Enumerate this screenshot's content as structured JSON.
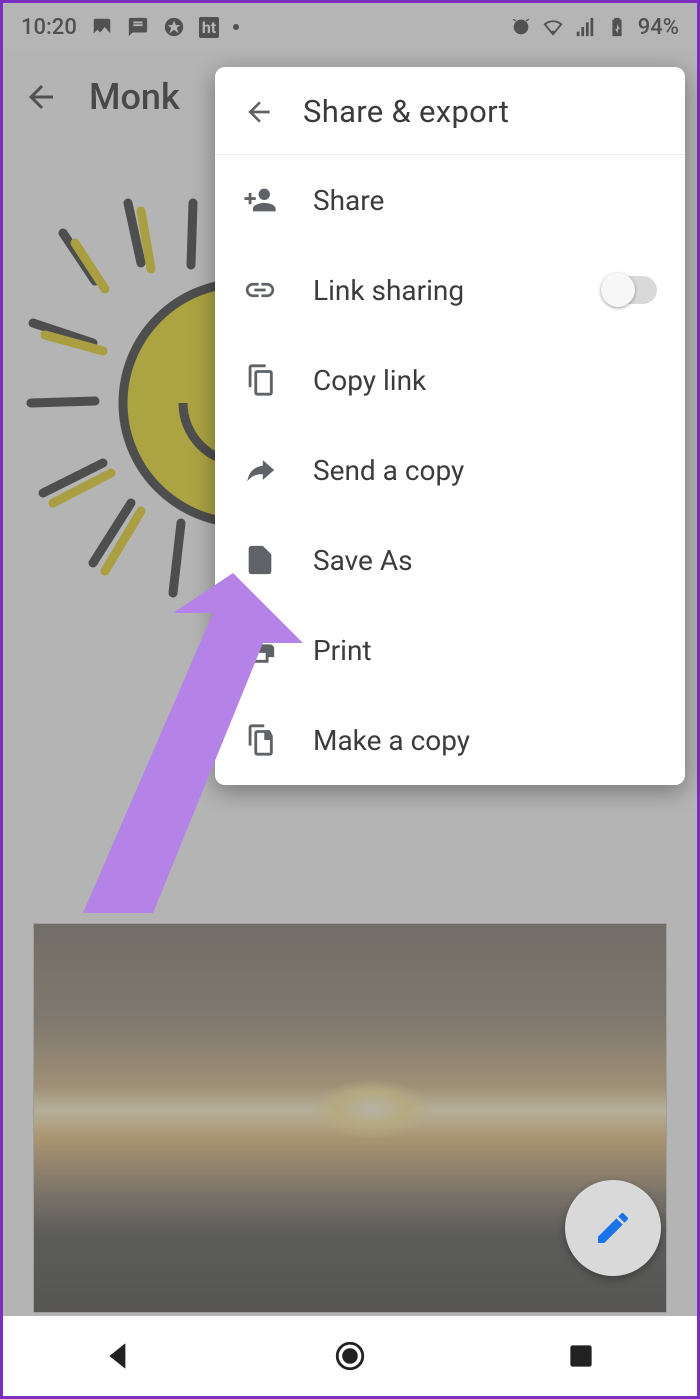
{
  "status": {
    "time": "10:20",
    "battery_text": "94%",
    "icons": [
      "picture-icon",
      "message-icon",
      "badge-icon",
      "ht-icon"
    ],
    "right_icons": [
      "alarm-icon",
      "wifi-icon",
      "signal-icon",
      "battery-icon"
    ]
  },
  "header": {
    "title": "Monk"
  },
  "popup": {
    "title": "Share & export",
    "items": [
      {
        "id": "share",
        "label": "Share",
        "icon": "person-add-icon",
        "toggle": false
      },
      {
        "id": "link-sharing",
        "label": "Link sharing",
        "icon": "link-icon",
        "toggle": true,
        "toggle_on": false
      },
      {
        "id": "copy-link",
        "label": "Copy link",
        "icon": "copy-icon",
        "toggle": false
      },
      {
        "id": "send-copy",
        "label": "Send a copy",
        "icon": "send-icon",
        "toggle": false
      },
      {
        "id": "save-as",
        "label": "Save As",
        "icon": "file-icon",
        "toggle": false
      },
      {
        "id": "print",
        "label": "Print",
        "icon": "print-icon",
        "toggle": false
      },
      {
        "id": "make-copy",
        "label": "Make a copy",
        "icon": "duplicate-icon",
        "toggle": false
      }
    ]
  },
  "annotation": {
    "target_item": "save-as",
    "arrow_color": "#b583e8"
  },
  "fab": {
    "icon": "pencil-icon"
  }
}
